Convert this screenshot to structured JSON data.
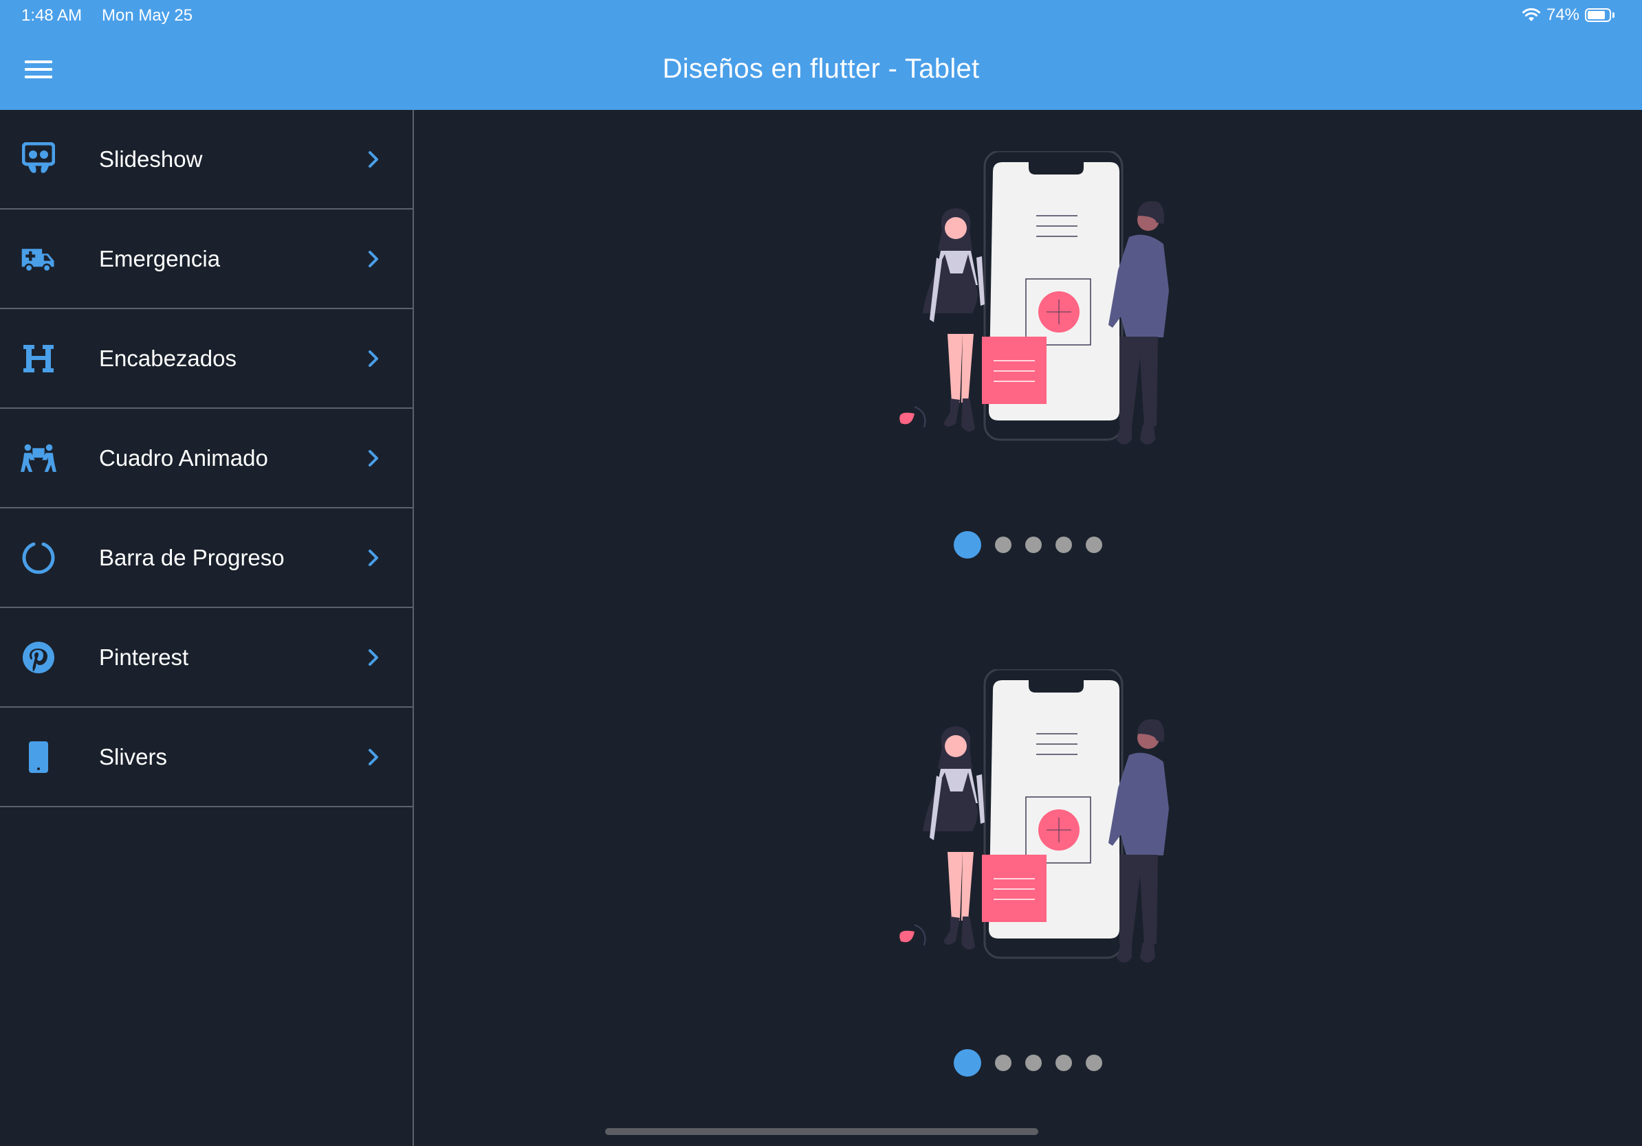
{
  "status_bar": {
    "time": "1:48 AM",
    "date": "Mon May 25",
    "battery": "74%"
  },
  "app_bar": {
    "title": "Diseños en flutter - Tablet"
  },
  "sidebar": {
    "items": [
      {
        "label": "Slideshow",
        "icon": "slideshare-icon"
      },
      {
        "label": "Emergencia",
        "icon": "ambulance-icon"
      },
      {
        "label": "Encabezados",
        "icon": "heading-icon"
      },
      {
        "label": "Cuadro Animado",
        "icon": "people-carry-icon"
      },
      {
        "label": "Barra de Progreso",
        "icon": "circle-notch-icon"
      },
      {
        "label": "Pinterest",
        "icon": "pinterest-icon"
      },
      {
        "label": "Slivers",
        "icon": "mobile-icon"
      }
    ]
  },
  "slideshows": [
    {
      "active_index": 0,
      "dot_count": 5
    },
    {
      "active_index": 0,
      "dot_count": 5
    }
  ],
  "colors": {
    "accent": "#4a9fe9",
    "background": "#1a212c",
    "pink": "#ff6584",
    "divider": "#5c626b"
  }
}
